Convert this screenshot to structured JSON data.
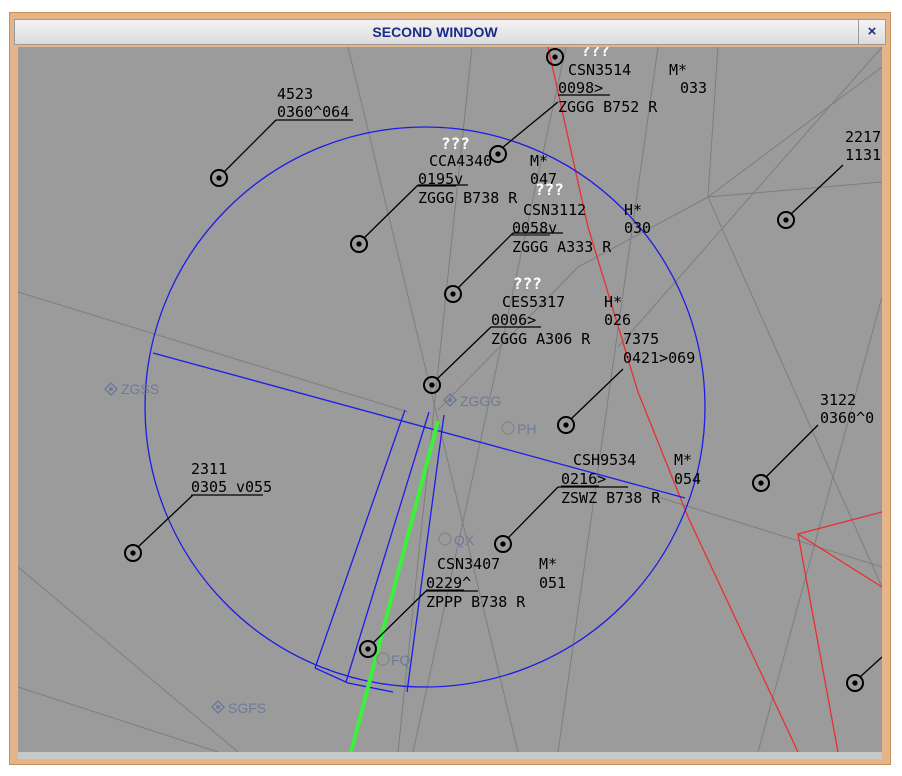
{
  "window": {
    "title": "SECOND WINDOW",
    "close_label": "×"
  },
  "colors": {
    "radar_bg": "#9b9b9b",
    "range_ring": "#1c1ce8",
    "route_red": "#e83030",
    "ils_green": "#3cf03c"
  },
  "fixes": [
    "ZGSS",
    "ZGGG",
    "PH",
    "QX",
    "FQ",
    "SGFS"
  ],
  "targets": [
    {
      "line1": "4523",
      "line2": "0360^064"
    },
    {
      "line1": "2311",
      "line2a": "0305",
      "line2b": "v055"
    },
    {
      "status": "???",
      "callsign": "CSN3514",
      "wake": "M*",
      "alt": "0098>",
      "rfl": "033",
      "route": "ZGGG B752 R"
    },
    {
      "status": "???",
      "callsign": "CCA4340",
      "wake": "M*",
      "alt": "0195v",
      "rfl": "047",
      "route": "ZGGG B738 R"
    },
    {
      "status": "???",
      "callsign": "CSN3112",
      "wake": "H*",
      "alt": "0058v",
      "rfl": "030",
      "route": "ZGGG A333 R"
    },
    {
      "status": "???",
      "callsign": "CES5317",
      "wake": "H*",
      "alt": "0006>",
      "rfl": "026",
      "route": "ZGGG A306 R",
      "extra1": "7375",
      "extra2": "0421>069"
    },
    {
      "callsign": "CSH9534",
      "wake": "M*",
      "alt": "0216>",
      "rfl": "054",
      "route": "ZSWZ B738 R"
    },
    {
      "callsign": "CSN3407",
      "wake": "M*",
      "alt": "0229^",
      "rfl": "051",
      "route": "ZPPP B738 R"
    },
    {
      "line1": "2217",
      "line2": "1131"
    },
    {
      "line1": "3122",
      "line2": "0360^0"
    }
  ]
}
